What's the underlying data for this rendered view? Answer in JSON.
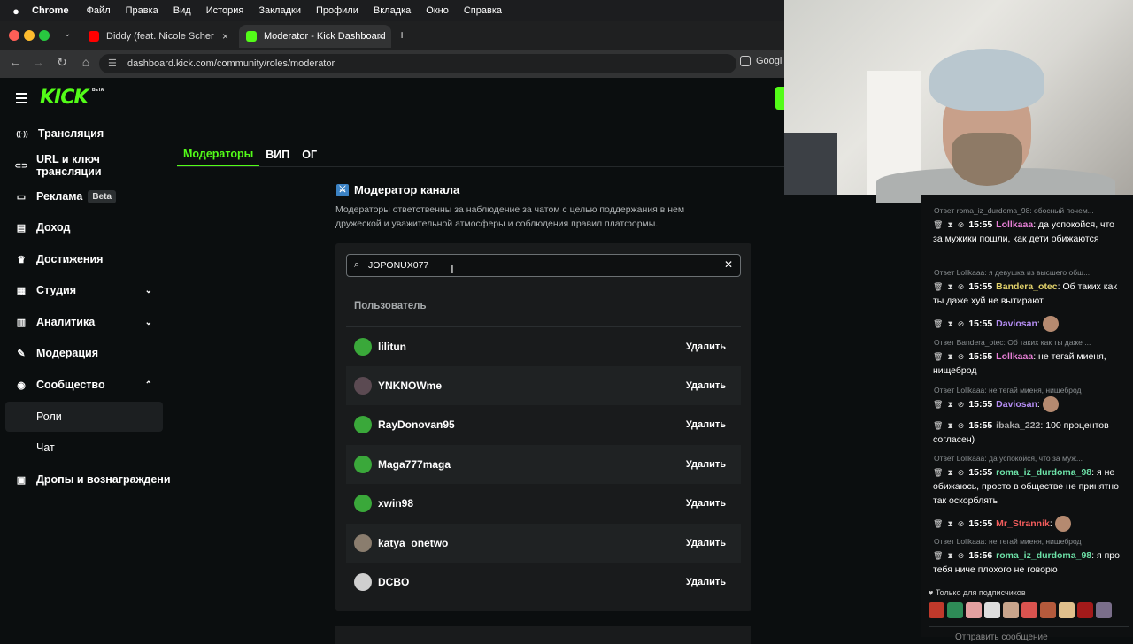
{
  "menubar": {
    "apple": "",
    "app": "Chrome",
    "items": [
      "Файл",
      "Правка",
      "Вид",
      "История",
      "Закладки",
      "Профили",
      "Вкладка",
      "Окно",
      "Справка"
    ]
  },
  "tabs": [
    {
      "title": "Diddy (feat. Nicole Scherzinger",
      "close": "×"
    },
    {
      "title": "Moderator - Kick Dashboard",
      "close": "×"
    }
  ],
  "new_tab": "+",
  "address": {
    "url": "dashboard.kick.com/community/roles/moderator",
    "google_chip": "Googl"
  },
  "logo": {
    "text": "KICK",
    "beta": "BETA"
  },
  "sidebar": {
    "items": [
      {
        "label": "Трансляция",
        "icon": "broadcast-icon",
        "glyph": "((·))"
      },
      {
        "label": "URL и ключ трансляции",
        "icon": "link-icon",
        "glyph": "⊂⊃"
      },
      {
        "label": "Реклама",
        "badge": "Beta",
        "icon": "ad-icon",
        "glyph": "▭"
      },
      {
        "label": "Доход",
        "icon": "income-icon",
        "glyph": "▤"
      },
      {
        "label": "Достижения",
        "icon": "trophy-icon",
        "glyph": "♛"
      },
      {
        "label": "Студия",
        "icon": "studio-icon",
        "glyph": "▦",
        "chevron": "⌄"
      },
      {
        "label": "Аналитика",
        "icon": "analytics-icon",
        "glyph": "▥",
        "chevron": "⌄"
      },
      {
        "label": "Модерация",
        "icon": "wrench-icon",
        "glyph": "✎"
      },
      {
        "label": "Сообщество",
        "icon": "community-icon",
        "glyph": "◉",
        "chevron": "⌃"
      },
      {
        "label": "Роли"
      },
      {
        "label": "Чат"
      },
      {
        "label": "Дропы и вознаграждени",
        "icon": "gift-icon",
        "glyph": "▣"
      }
    ]
  },
  "page_tabs": [
    "Модераторы",
    "ВИП",
    "ОГ"
  ],
  "panel": {
    "title": "Модератор канала",
    "description": "Модераторы ответственны за наблюдение за чатом с целью поддержания в нем дружеской и уважительной атмосферы и соблюдения правил платформы.",
    "search_value": "JOPONUX077",
    "column_header": "Пользователь",
    "remove_label": "Удалить",
    "moderators": [
      {
        "name": "lilitun",
        "avatar_color": "#3aa83a"
      },
      {
        "name": "YNKNOWme",
        "avatar_color": "#5b4a52"
      },
      {
        "name": "RayDonovan95",
        "avatar_color": "#3aa83a"
      },
      {
        "name": "Maga777maga",
        "avatar_color": "#3aa83a"
      },
      {
        "name": "xwin98",
        "avatar_color": "#3aa83a"
      },
      {
        "name": "katya_onetwo",
        "avatar_color": "#8a7d6e"
      },
      {
        "name": "DCBO",
        "avatar_color": "#cfcfcf"
      }
    ]
  },
  "chat": {
    "messages": [
      {
        "reply": "Ответ roma_iz_durdoma_98: обосный почем...",
        "time": "15:55",
        "user": "Lollkaaa",
        "user_color": "#e77fd6",
        "text": "да успокойся, что за мужики пошли, как дети обижаются"
      },
      {
        "reply": "Ответ Lollkaaa: я девушка из высшего общ...",
        "time": "15:55",
        "user": "Bandera_otec",
        "user_color": "#e2d26b",
        "text": "Об таких как ты даже хуй не вытирают"
      },
      {
        "reply": "",
        "time": "15:55",
        "user": "Daviosan",
        "user_color": "#b48cf2",
        "text": ""
      },
      {
        "reply": "Ответ Bandera_otec: Об таких как ты даже ...",
        "time": "15:55",
        "user": "Lollkaaa",
        "user_color": "#e77fd6",
        "text": "не тегай миеня, нищеброд"
      },
      {
        "reply": "Ответ Lollkaaa: не тегай миеня, нищеброд",
        "time": "15:55",
        "user": "Daviosan",
        "user_color": "#b48cf2",
        "text": ""
      },
      {
        "reply": "",
        "time": "15:55",
        "user": "ibaka_222",
        "user_color": "#a8a8a8",
        "text": "100 процентов согласен)"
      },
      {
        "reply": "Ответ Lollkaaa: да успокойся, что за муж...",
        "time": "15:55",
        "user": "roma_iz_durdoma_98",
        "user_color": "#6de2a8",
        "text": "я не обижаюсь, просто в обществе не принятно так оскорблять"
      },
      {
        "reply": "",
        "time": "15:55",
        "user": "Mr_Strannik",
        "user_color": "#f25c5c",
        "text": ""
      },
      {
        "reply": "Ответ Lollkaaa: не тегай миеня, нищеброд",
        "time": "15:56",
        "user": "roma_iz_durdoma_98",
        "user_color": "#6de2a8",
        "text": "я про тебя ниче плохого не говорю"
      }
    ],
    "subs_only": "Только для подписчиков",
    "input_placeholder": "Отправить сообщение"
  }
}
